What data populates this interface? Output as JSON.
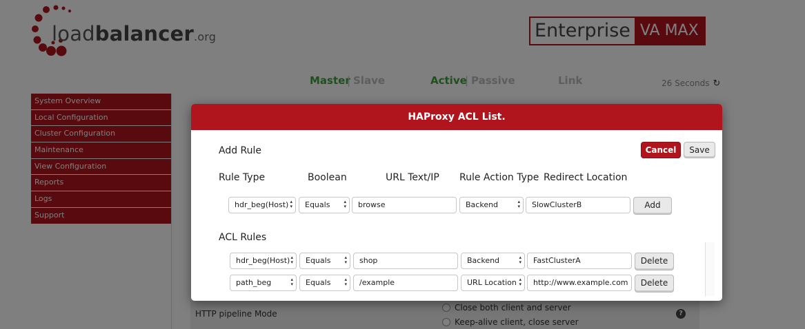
{
  "logo": {
    "main": "load",
    "bold": "balancer",
    "suffix": ".org"
  },
  "edition": {
    "name": "Enterprise",
    "tier": "VA MAX"
  },
  "status": {
    "master": "Master",
    "slave": "Slave",
    "sep": "|",
    "active": "Active",
    "passive": "Passive",
    "link": "Link",
    "refresh": "26 Seconds"
  },
  "sidebar": {
    "items": [
      {
        "label": "System Overview"
      },
      {
        "label": "Local Configuration"
      },
      {
        "label": "Cluster Configuration"
      },
      {
        "label": "Maintenance"
      },
      {
        "label": "View Configuration"
      },
      {
        "label": "Reports"
      },
      {
        "label": "Logs"
      },
      {
        "label": "Support"
      }
    ]
  },
  "background_form": {
    "row_label": "HTTP pipeline Mode",
    "options": [
      "Close both client and server",
      "Keep-alive client, close server"
    ]
  },
  "modal": {
    "title": "HAProxy ACL List.",
    "add_rule_title": "Add Rule",
    "cancel_label": "Cancel",
    "save_label": "Save",
    "columns": [
      "Rule Type",
      "Boolean",
      "URL Text/IP",
      "Rule Action Type",
      "Redirect Location"
    ],
    "new_rule": {
      "rule_type": "hdr_beg(Host)",
      "boolean": "Equals",
      "url_text": "browse",
      "action_type": "Backend",
      "location": "SlowClusterB",
      "add_label": "Add"
    },
    "acl_rules_title": "ACL Rules",
    "rules": [
      {
        "rule_type": "hdr_beg(Host)",
        "boolean": "Equals",
        "url_text": "shop",
        "action_type": "Backend",
        "location": "FastClusterA",
        "delete_label": "Delete"
      },
      {
        "rule_type": "path_beg",
        "boolean": "Equals",
        "url_text": "/example",
        "action_type": "URL Location",
        "location": "http://www.example.com",
        "delete_label": "Delete"
      }
    ]
  },
  "colors": {
    "brand_red": "#b0141d",
    "status_green": "#3f9d3f"
  },
  "icons": {
    "refresh": "refresh-icon",
    "help": "help-icon"
  }
}
